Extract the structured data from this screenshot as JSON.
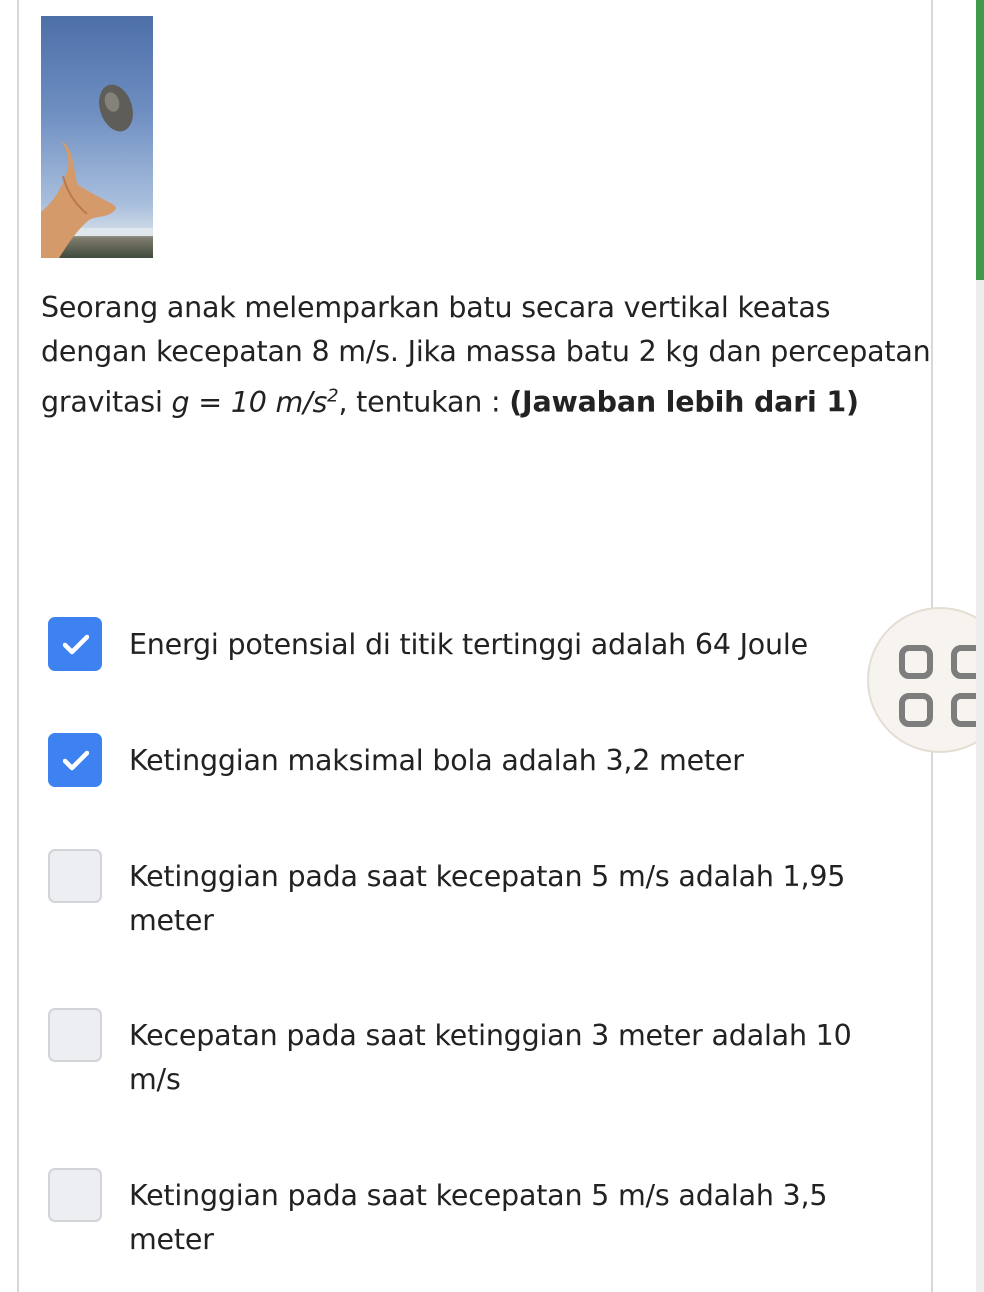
{
  "question": {
    "text_1": "Seorang anak melemparkan batu secara vertikal keatas dengan kecepatan 8 m/s. Jika massa batu 2 kg dan percepatan gravitasi ",
    "math_lhs": "g = 10 m/s",
    "math_exp": "2",
    "text_2": ", tentukan : ",
    "instruction": "(Jawaban lebih dari 1)"
  },
  "options": [
    {
      "label": "Energi potensial di titik tertinggi adalah 64 Joule",
      "checked": true
    },
    {
      "label": "Ketinggian maksimal bola adalah 3,2 meter",
      "checked": true
    },
    {
      "label": "Ketinggian pada saat kecepatan 5 m/s adalah 1,95 meter",
      "checked": false
    },
    {
      "label": "Kecepatan pada saat ketinggian 3 meter adalah 10 m/s",
      "checked": false
    },
    {
      "label": "Ketinggian pada saat kecepatan 5 m/s adalah 3,5 meter",
      "checked": false
    }
  ],
  "colors": {
    "checkbox_checked": "#3d82f0",
    "checkbox_unchecked": "#eceef1",
    "scrollbar_thumb": "#3f9a4a"
  },
  "icons": {
    "fab": "grid-view-icon",
    "check": "checkmark-icon"
  }
}
